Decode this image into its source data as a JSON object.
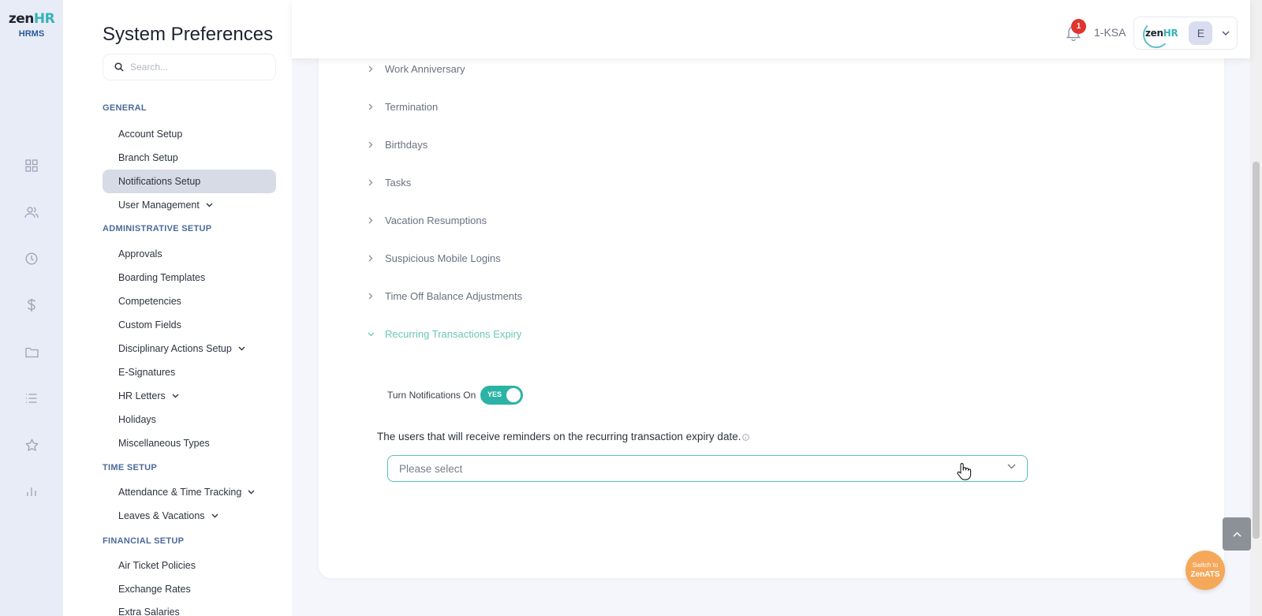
{
  "app": {
    "brand_main": "zen",
    "brand_accent": "HR",
    "brand_sub": "HRMS"
  },
  "rail": {
    "icons": [
      "dashboard-icon",
      "people-icon",
      "clock-icon",
      "dollar-icon",
      "folder-icon",
      "list-icon",
      "star-icon",
      "bar-chart-icon"
    ]
  },
  "sidebar": {
    "title": "System Preferences",
    "search_placeholder": "Search...",
    "sections": {
      "general": "GENERAL",
      "administrative": "ADMINISTRATIVE SETUP",
      "time": "TIME SETUP",
      "financial": "FINANCIAL SETUP"
    },
    "items": {
      "account_setup": "Account Setup",
      "branch_setup": "Branch Setup",
      "notifications_setup": "Notifications Setup",
      "user_management": "User Management",
      "approvals": "Approvals",
      "boarding_templates": "Boarding Templates",
      "competencies": "Competencies",
      "custom_fields": "Custom Fields",
      "disciplinary_actions_setup": "Disciplinary Actions Setup",
      "e_signatures": "E-Signatures",
      "hr_letters": "HR Letters",
      "holidays": "Holidays",
      "miscellaneous_types": "Miscellaneous Types",
      "attendance_time_tracking": "Attendance & Time Tracking",
      "leaves_vacations": "Leaves & Vacations",
      "air_ticket_policies": "Air Ticket Policies",
      "exchange_rates": "Exchange Rates",
      "extra_salaries": "Extra Salaries"
    },
    "active": "notifications_setup"
  },
  "header": {
    "notification_count": "1",
    "company": "1-KSA",
    "account_logo_main": "zen",
    "account_logo_accent": "HR",
    "avatar_initial": "E"
  },
  "main": {
    "accordion": [
      "Work Anniversary",
      "Termination",
      "Birthdays",
      "Tasks",
      "Vacation Resumptions",
      "Suspicious Mobile Logins",
      "Time Off Balance Adjustments",
      "Recurring Transactions Expiry"
    ],
    "open_section": "Recurring Transactions Expiry",
    "toggle_label": "Turn Notifications On",
    "toggle_value": "YES",
    "description": "The users that will receive reminders on the recurring transaction expiry date.",
    "select_placeholder": "Please select"
  },
  "floating": {
    "switch_line1": "Switch to",
    "switch_line2": "ZenATS"
  },
  "colors": {
    "accent_teal": "#2bb3a5",
    "open_section": "#6cc7b5",
    "badge_red": "#e0342f",
    "switch_orange": "#f5a85a",
    "section_label": "#4b6a9a"
  }
}
